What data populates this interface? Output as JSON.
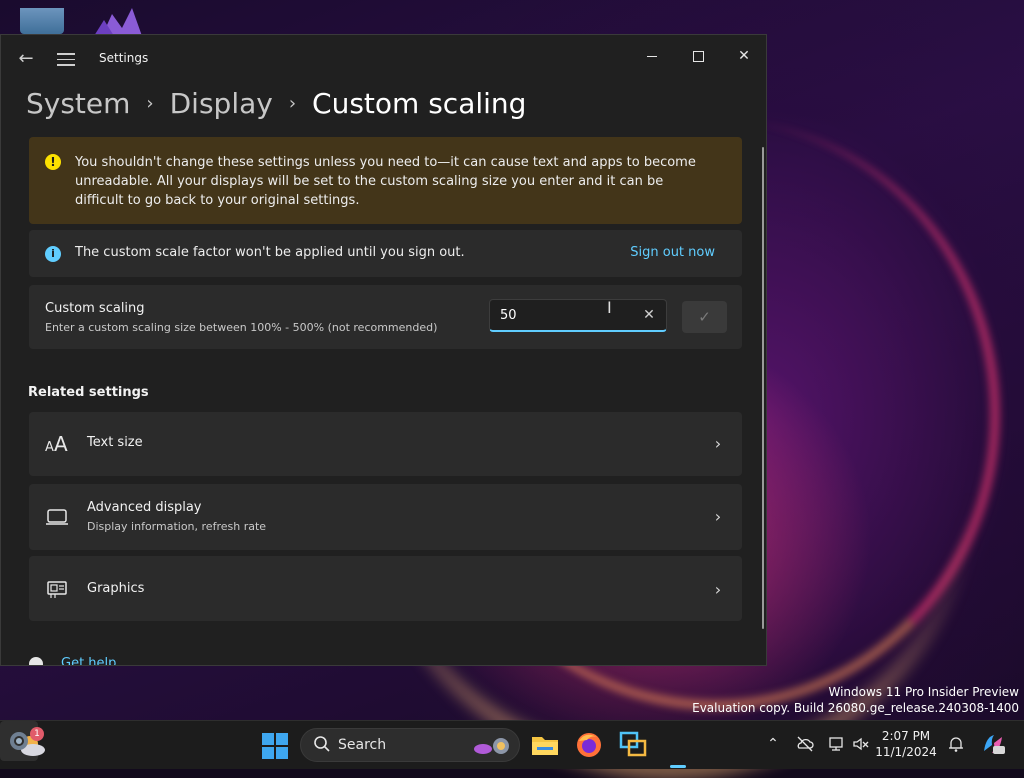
{
  "window": {
    "title": "Settings",
    "breadcrumb": {
      "items": [
        "System",
        "Display"
      ],
      "current": "Custom scaling"
    }
  },
  "warning": {
    "icon": "warning-icon",
    "text": "You shouldn't change these settings unless you need to—it can cause text and apps to become unreadable. All your displays will be set to the custom scaling size you enter and it can be difficult to go back to your original settings."
  },
  "info": {
    "icon": "info-icon",
    "text": "The custom scale factor won't be applied until you sign out.",
    "link": "Sign out now"
  },
  "custom_scaling": {
    "title": "Custom scaling",
    "description": "Enter a custom scaling size between 100% - 500% (not recommended)",
    "value": "50"
  },
  "related": {
    "title": "Related settings",
    "items": [
      {
        "label": "Text size",
        "sub": "",
        "icon": "text-size-icon"
      },
      {
        "label": "Advanced display",
        "sub": "Display information, refresh rate",
        "icon": "monitor-icon"
      },
      {
        "label": "Graphics",
        "sub": "",
        "icon": "graphics-card-icon"
      }
    ]
  },
  "help": {
    "label": "Get help"
  },
  "watermark": {
    "line1": "Windows 11 Pro Insider Preview",
    "line2": "Evaluation copy. Build 26080.ge_release.240308-1400"
  },
  "taskbar": {
    "search_label": "Search",
    "widget_badge": "1",
    "clock_time": "2:07 PM",
    "clock_date": "11/1/2024"
  },
  "colors": {
    "accent": "#60cdff",
    "warning_bg": "#433519",
    "warning_icon": "#fce100",
    "card_bg": "#2b2b2b",
    "window_bg": "#202020"
  }
}
